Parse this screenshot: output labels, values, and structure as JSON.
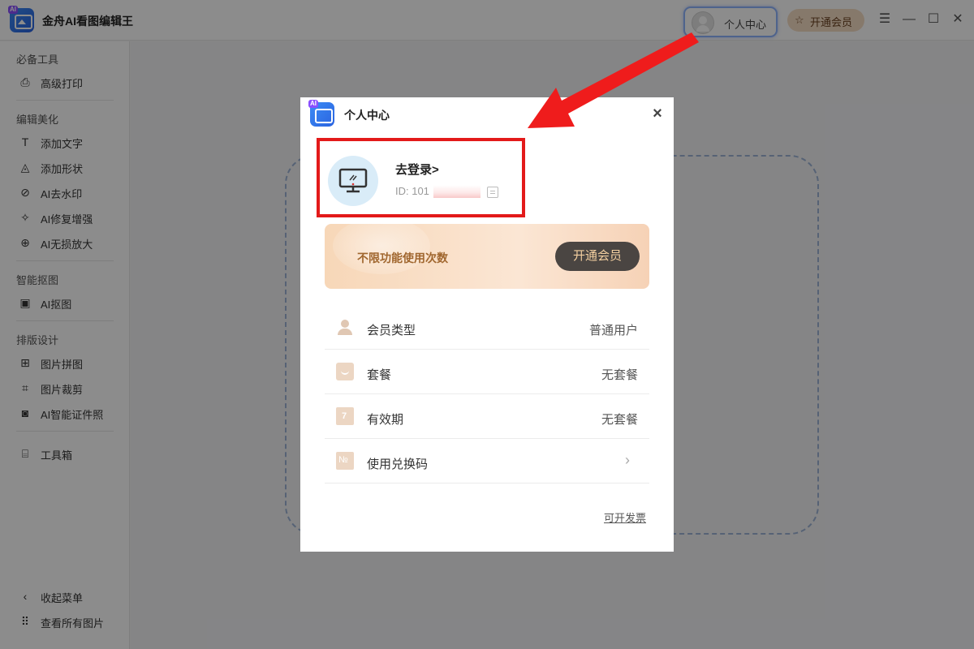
{
  "app": {
    "title": "金舟AI看图编辑王",
    "ai_tag": "AI"
  },
  "titlebar": {
    "user_center_label": "个人中心",
    "vip_label": "开通会员",
    "window_icons": [
      "menu-icon",
      "minimize-icon",
      "maximize-icon",
      "close-icon"
    ]
  },
  "sidebar": {
    "sections": [
      {
        "title": "必备工具",
        "items": [
          {
            "label": "高级打印",
            "icon": "printer-icon"
          }
        ]
      },
      {
        "title": "编辑美化",
        "items": [
          {
            "label": "添加文字",
            "icon": "text-icon"
          },
          {
            "label": "添加形状",
            "icon": "shapes-icon"
          },
          {
            "label": "AI去水印",
            "icon": "watermark-icon"
          },
          {
            "label": "AI修复增强",
            "icon": "repair-icon"
          },
          {
            "label": "AI无损放大",
            "icon": "zoom-icon"
          }
        ]
      },
      {
        "title": "智能抠图",
        "items": [
          {
            "label": "AI抠图",
            "icon": "image-cutout-icon"
          }
        ]
      },
      {
        "title": "排版设计",
        "items": [
          {
            "label": "图片拼图",
            "icon": "collage-icon"
          },
          {
            "label": "图片裁剪",
            "icon": "crop-icon"
          },
          {
            "label": "AI智能证件照",
            "icon": "id-photo-icon"
          }
        ]
      }
    ],
    "toolbox": {
      "label": "工具箱",
      "icon": "toolbox-icon"
    },
    "bottom": [
      {
        "label": "收起菜单",
        "icon": "collapse-icon"
      },
      {
        "label": "查看所有图片",
        "icon": "grid-icon"
      }
    ]
  },
  "dialog": {
    "title": "个人中心",
    "ai_tag": "AI",
    "profile": {
      "login_text": "去登录>",
      "id_prefix": "ID: 101"
    },
    "banner": {
      "text": "不限功能使用次数",
      "button": "开通会员"
    },
    "rows": [
      {
        "label": "会员类型",
        "value": "普通用户",
        "icon": "person-icon"
      },
      {
        "label": "套餐",
        "value": "无套餐",
        "icon": "package-icon"
      },
      {
        "label": "有效期",
        "value": "无套餐",
        "icon": "calendar-icon"
      },
      {
        "label": "使用兑换码",
        "value": "",
        "icon": "code-icon"
      }
    ],
    "invoice_link": "可开发票"
  },
  "colors": {
    "accent_red": "#e31a1a",
    "banner_button": "#4a4542",
    "vip_gold": "#a0662e"
  }
}
